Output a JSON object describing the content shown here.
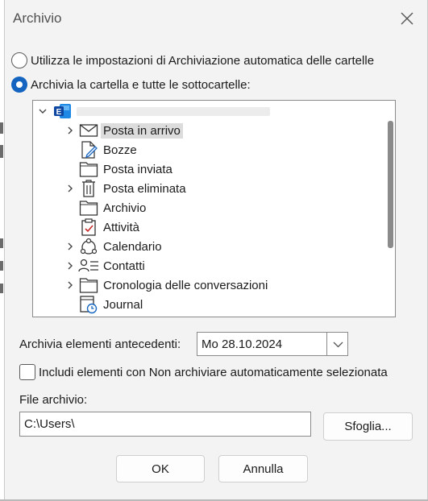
{
  "dialog": {
    "title": "Archivio"
  },
  "options": {
    "auto_archive_label": "Utilizza le impostazioni di Archiviazione automatica delle cartelle",
    "archive_folder_label": "Archivia la cartella e tutte le sottocartelle:",
    "selected": "archive_folder"
  },
  "tree": {
    "items": [
      {
        "label": "Posta in arrivo",
        "icon": "inbox-icon",
        "expandable": true,
        "selected": true
      },
      {
        "label": "Bozze",
        "icon": "drafts-icon",
        "expandable": false
      },
      {
        "label": "Posta inviata",
        "icon": "folder-icon",
        "expandable": false
      },
      {
        "label": "Posta eliminata",
        "icon": "trash-icon",
        "expandable": true
      },
      {
        "label": "Archivio",
        "icon": "folder-icon",
        "expandable": false
      },
      {
        "label": "Attività",
        "icon": "tasks-icon",
        "expandable": false
      },
      {
        "label": "Calendario",
        "icon": "calendar-icon",
        "expandable": true
      },
      {
        "label": "Contatti",
        "icon": "contacts-icon",
        "expandable": true
      },
      {
        "label": "Cronologia delle conversazioni",
        "icon": "folder-icon",
        "expandable": true
      },
      {
        "label": "Journal",
        "icon": "journal-icon",
        "expandable": false
      }
    ]
  },
  "archive_before": {
    "label": "Archivia elementi antecedenti:",
    "value": "Mo 28.10.2024"
  },
  "include_checkbox": {
    "label": "Includi elementi con Non archiviare automaticamente selezionata",
    "checked": false
  },
  "file": {
    "label": "File archivio:",
    "value": "C:\\Users\\",
    "browse_label": "Sfoglia..."
  },
  "buttons": {
    "ok": "OK",
    "cancel": "Annulla"
  },
  "colors": {
    "accent": "#1565c0",
    "dialog_bg": "#f3f3f3"
  }
}
